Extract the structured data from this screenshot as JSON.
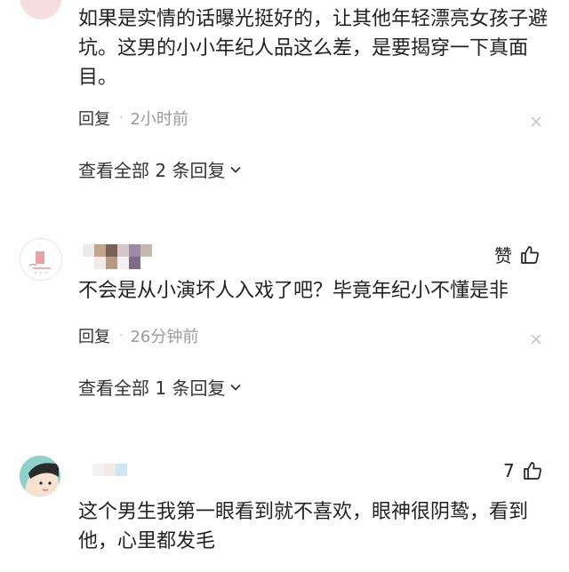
{
  "comment1": {
    "text": "如果是实情的话曝光挺好的，让其他年轻漂亮女孩子避坑。这男的小小年纪人品这么差，是要揭穿一下真面目。",
    "reply_label": "回复",
    "time": "2小时前",
    "view_all_label": "查看全部 2 条回复"
  },
  "comment2": {
    "text": "不会是从小演坏人入戏了吧？毕竟年纪小不懂是非",
    "like_label": "赞",
    "reply_label": "回复",
    "time": "26分钟前",
    "view_all_label": "查看全部 1 条回复"
  },
  "comment3": {
    "text": "这个男生我第一眼看到就不喜欢，眼神很阴鸷，看到他，心里都发毛",
    "like_count": "7"
  },
  "colors": {
    "text": "#222222",
    "secondary": "#9a9a9a",
    "icon": "#c8c8c8"
  },
  "icons": [
    "close-icon",
    "chevron-down-icon",
    "thumbs-up-icon"
  ]
}
